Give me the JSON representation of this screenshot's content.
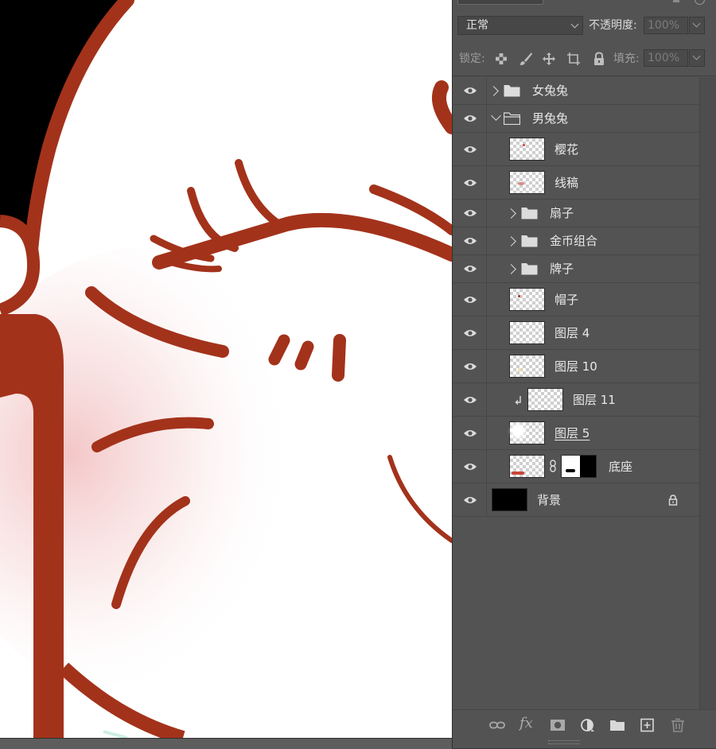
{
  "blend_mode": "正常",
  "opacity": {
    "label": "不透明度:",
    "value": "100%"
  },
  "lock": {
    "label": "锁定:"
  },
  "fill": {
    "label": "填充:",
    "value": "100%"
  },
  "layers": [
    {
      "name": "女兔兔",
      "type": "group",
      "expanded": false
    },
    {
      "name": "男兔兔",
      "type": "group",
      "expanded": true
    },
    {
      "name": "樱花",
      "type": "layer"
    },
    {
      "name": "线稿",
      "type": "layer"
    },
    {
      "name": "扇子",
      "type": "group",
      "expanded": false
    },
    {
      "name": "金币组合",
      "type": "group",
      "expanded": false
    },
    {
      "name": "牌子",
      "type": "group",
      "expanded": false
    },
    {
      "name": "帽子",
      "type": "layer"
    },
    {
      "name": "图层 4",
      "type": "layer"
    },
    {
      "name": "图层 10",
      "type": "layer"
    },
    {
      "name": "图层 11",
      "type": "layer",
      "clipped": true
    },
    {
      "name": "图层 5",
      "type": "layer"
    },
    {
      "name": "底座",
      "type": "layer",
      "has_mask": true
    },
    {
      "name": "背景",
      "type": "background",
      "locked": true
    }
  ],
  "colors": {
    "panel_bg": "#535353",
    "artwork_red": "#a3321b",
    "cheek_blush": "#f3c5c5"
  },
  "icons": {
    "lock_row": [
      "lock-transparent-icon",
      "lock-brush-icon",
      "lock-move-icon",
      "lock-artboard-icon",
      "lock-all-icon"
    ],
    "bottom": [
      "link-layers-icon",
      "fx-icon",
      "add-mask-icon",
      "adjustment-layer-icon",
      "new-group-icon",
      "new-layer-icon",
      "delete-icon"
    ]
  }
}
